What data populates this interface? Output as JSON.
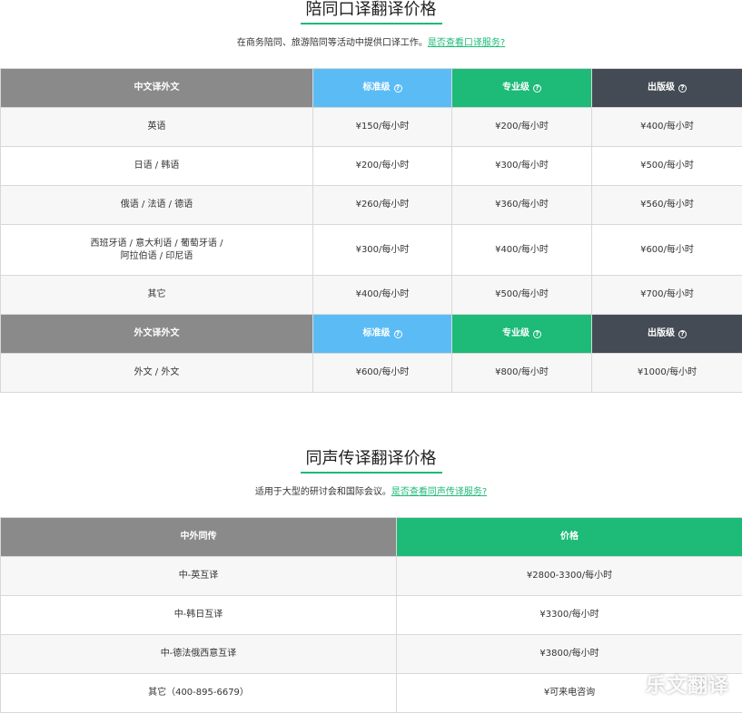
{
  "section1": {
    "title": "陪同口译翻译价格",
    "subtitle": "在商务陪同、旅游陪同等活动中提供口译工作。",
    "link": "是否查看口译服务?",
    "header1": {
      "col0": "中文译外文",
      "col1": "标准级",
      "col2": "专业级",
      "col3": "出版级"
    },
    "rows1": [
      {
        "lang": "英语",
        "std": "¥150/每小时",
        "pro": "¥200/每小时",
        "pub": "¥400/每小时"
      },
      {
        "lang": "日语 / 韩语",
        "std": "¥200/每小时",
        "pro": "¥300/每小时",
        "pub": "¥500/每小时"
      },
      {
        "lang": "俄语 / 法语 / 德语",
        "std": "¥260/每小时",
        "pro": "¥360/每小时",
        "pub": "¥560/每小时"
      },
      {
        "lang_line1": "西班牙语 / 意大利语 / 葡萄牙语 /",
        "lang_line2": "阿拉伯语 / 印尼语",
        "std": "¥300/每小时",
        "pro": "¥400/每小时",
        "pub": "¥600/每小时"
      },
      {
        "lang": "其它",
        "std": "¥400/每小时",
        "pro": "¥500/每小时",
        "pub": "¥700/每小时"
      }
    ],
    "header2": {
      "col0": "外文译外文",
      "col1": "标准级",
      "col2": "专业级",
      "col3": "出版级"
    },
    "rows2": [
      {
        "lang": "外文 / 外文",
        "std": "¥600/每小时",
        "pro": "¥800/每小时",
        "pub": "¥1000/每小时"
      }
    ]
  },
  "section2": {
    "title": "同声传译翻译价格",
    "subtitle": "适用于大型的研讨会和国际会议。",
    "link": "是否查看同声传译服务?",
    "header": {
      "col0": "中外同传",
      "col1": "价格"
    },
    "rows": [
      {
        "lang": "中-英互译",
        "price": "¥2800-3300/每小时"
      },
      {
        "lang": "中-韩日互译",
        "price": "¥3300/每小时"
      },
      {
        "lang": "中-德法俄西意互译",
        "price": "¥3800/每小时"
      },
      {
        "lang": "其它（400-895-6679）",
        "price": "¥可来电咨询"
      }
    ]
  },
  "watermark": "乐文翻译",
  "help_icon_glyph": "?",
  "colors": {
    "accent_green": "#1dba78",
    "header_blue": "#5bbcf5",
    "header_gray": "#8a8a8a",
    "header_dark": "#454b55"
  }
}
